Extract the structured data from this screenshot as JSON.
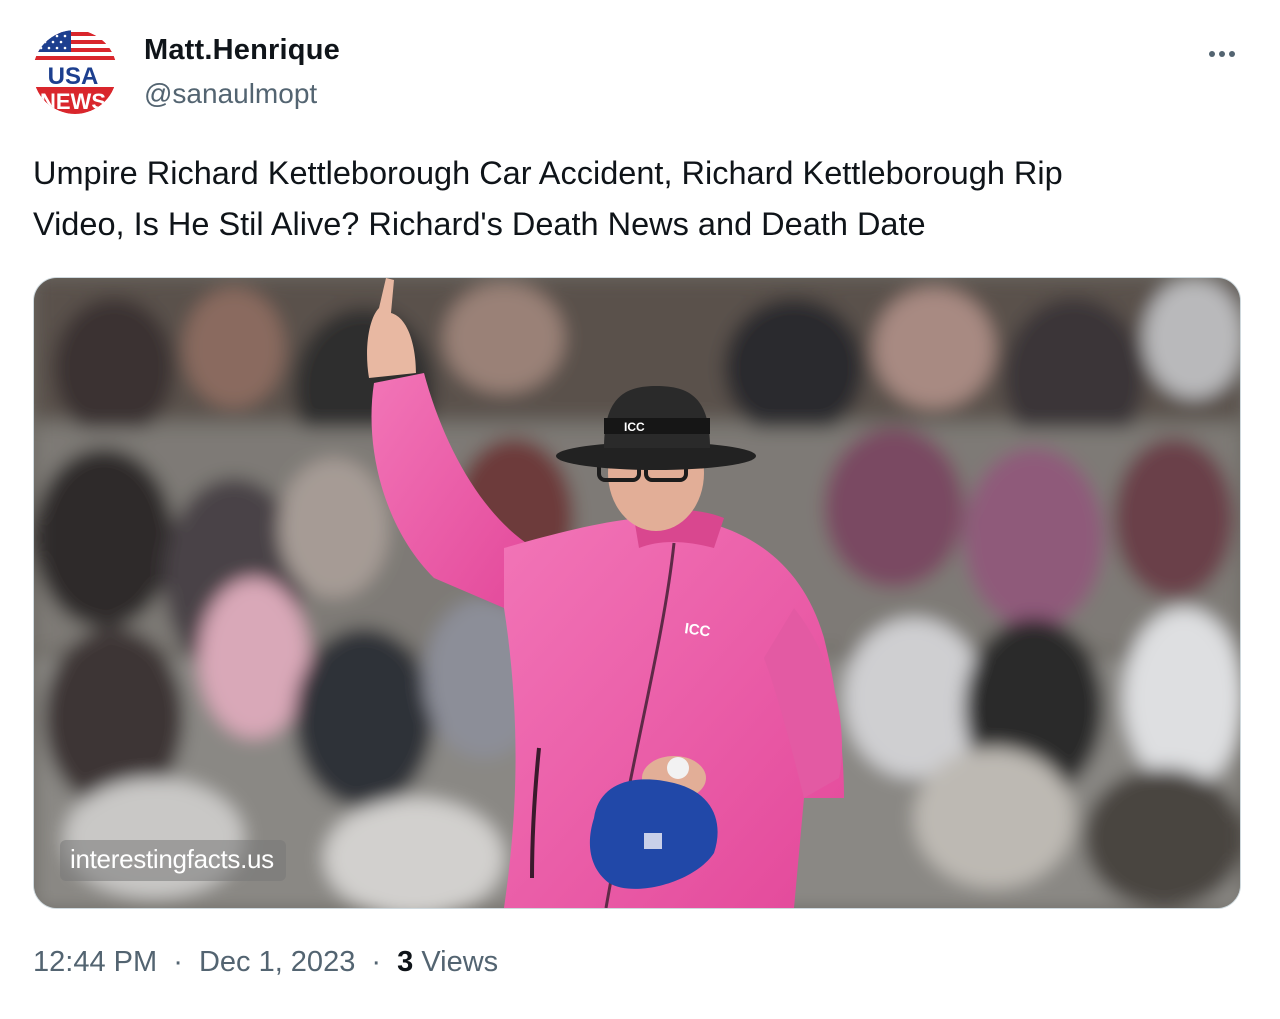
{
  "author": {
    "display_name": "Matt.Henrique",
    "handle": "@sanaulmopt",
    "avatar_top_text": "USA",
    "avatar_bottom_text": "NEWS"
  },
  "tweet": {
    "text": "Umpire Richard Kettleborough Car Accident, Richard Kettleborough Rip\nVideo, Is He Stil Alive? Richard's Death News and Death Date"
  },
  "media": {
    "watermark": "interestingfacts.us",
    "hat_logo": "ICC",
    "jacket_logo": "ICC",
    "colors": {
      "jacket": "#ee5aa8",
      "hat": "#222222",
      "cap": "#2148a8",
      "background": "#6b6862"
    }
  },
  "meta": {
    "time": "12:44 PM",
    "separator": "·",
    "date": "Dec 1, 2023",
    "views_count": "3",
    "views_label": "Views"
  },
  "icons": {
    "more": "more-horizontal-icon"
  }
}
